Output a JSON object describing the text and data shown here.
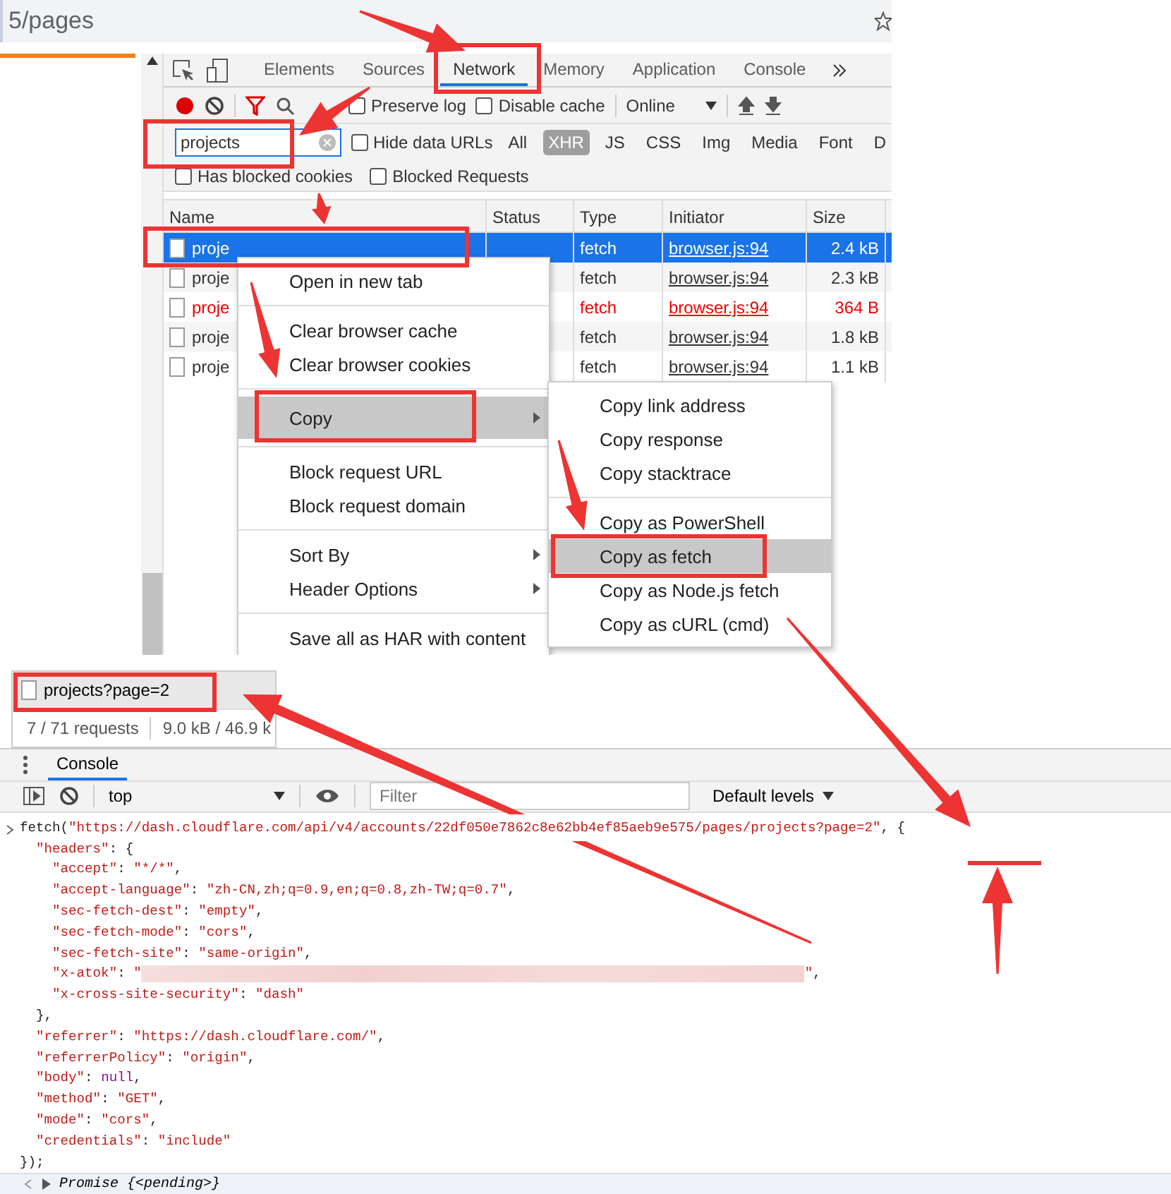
{
  "address_bar": {
    "url": "5/pages"
  },
  "devtools": {
    "tabs": [
      {
        "label": "Elements",
        "selected": false
      },
      {
        "label": "Sources",
        "selected": false
      },
      {
        "label": "Network",
        "selected": true
      },
      {
        "label": "Memory",
        "selected": false
      },
      {
        "label": "Application",
        "selected": false
      },
      {
        "label": "Console",
        "selected": false
      }
    ],
    "preserve_log": {
      "label": "Preserve log",
      "checked": false
    },
    "disable_cache": {
      "label": "Disable cache",
      "checked": false
    },
    "throttling": "Online",
    "filter": {
      "value": "projects"
    },
    "hide_data_urls": {
      "label": "Hide data URLs",
      "checked": false
    },
    "type_filters": [
      {
        "label": "All",
        "selected": false
      },
      {
        "label": "XHR",
        "selected": true
      },
      {
        "label": "JS",
        "selected": false
      },
      {
        "label": "CSS",
        "selected": false
      },
      {
        "label": "Img",
        "selected": false
      },
      {
        "label": "Media",
        "selected": false
      },
      {
        "label": "Font",
        "selected": false
      },
      {
        "label": "D",
        "selected": false
      }
    ],
    "has_blocked_cookies": {
      "label": "Has blocked cookies",
      "checked": false
    },
    "blocked_requests": {
      "label": "Blocked Requests",
      "checked": false
    },
    "columns": [
      "Name",
      "Status",
      "Type",
      "Initiator",
      "Size"
    ],
    "rows": [
      {
        "name": "proje",
        "type": "fetch",
        "initiator": "browser.js:94",
        "size": "2.4 kB",
        "selected": true,
        "failed": false
      },
      {
        "name": "proje",
        "type": "fetch",
        "initiator": "browser.js:94",
        "size": "2.3 kB",
        "selected": false,
        "failed": false
      },
      {
        "name": "proje",
        "type": "fetch",
        "initiator": "browser.js:94",
        "size": "364 B",
        "selected": false,
        "failed": true
      },
      {
        "name": "proje",
        "type": "fetch",
        "initiator": "browser.js:94",
        "size": "1.8 kB",
        "selected": false,
        "failed": false
      },
      {
        "name": "proje",
        "type": "fetch",
        "initiator": "browser.js:94",
        "size": "1.1 kB",
        "selected": false,
        "failed": false
      }
    ]
  },
  "context_menu": {
    "groups": [
      [
        {
          "label": "Open in new tab",
          "submenu": false,
          "highlighted": false
        }
      ],
      [
        {
          "label": "Clear browser cache",
          "submenu": false,
          "highlighted": false
        },
        {
          "label": "Clear browser cookies",
          "submenu": false,
          "highlighted": false
        }
      ],
      [
        {
          "label": "Copy",
          "submenu": true,
          "highlighted": true
        }
      ],
      [
        {
          "label": "Block request URL",
          "submenu": false,
          "highlighted": false
        },
        {
          "label": "Block request domain",
          "submenu": false,
          "highlighted": false
        }
      ],
      [
        {
          "label": "Sort By",
          "submenu": true,
          "highlighted": false
        },
        {
          "label": "Header Options",
          "submenu": true,
          "highlighted": false
        }
      ],
      [
        {
          "label": "Save all as HAR with content",
          "submenu": false,
          "highlighted": false
        }
      ]
    ]
  },
  "copy_submenu": {
    "groups": [
      [
        {
          "label": "Copy link address",
          "highlighted": false
        },
        {
          "label": "Copy response",
          "highlighted": false
        },
        {
          "label": "Copy stacktrace",
          "highlighted": false
        }
      ],
      [
        {
          "label": "Copy as PowerShell",
          "highlighted": false
        },
        {
          "label": "Copy as fetch",
          "highlighted": true
        },
        {
          "label": "Copy as Node.js fetch",
          "highlighted": false
        },
        {
          "label": "Copy as cURL (cmd)",
          "highlighted": false
        }
      ]
    ]
  },
  "request_list": {
    "row": "projects?page=2",
    "requests": "7 / 71 requests",
    "transferred": "9.0 kB / 46.9 k"
  },
  "console": {
    "tab": "Console",
    "context": "top",
    "filter_placeholder": "Filter",
    "levels": "Default levels",
    "lines": [
      [
        {
          "kind": "plain",
          "text": "fetch("
        },
        {
          "kind": "string",
          "text": "\"https://dash.cloudflare.com/api/v4/accounts/22df050e7862c8e62bb4ef85aeb9e575/pages/projects?page=2\""
        },
        {
          "kind": "plain",
          "text": ", {"
        }
      ],
      [
        {
          "kind": "string",
          "text": "\"headers\""
        },
        {
          "kind": "plain",
          "text": ": {"
        }
      ],
      [
        {
          "kind": "string",
          "text": "\"accept\""
        },
        {
          "kind": "plain",
          "text": ": "
        },
        {
          "kind": "string",
          "text": "\"*/*\""
        },
        {
          "kind": "plain",
          "text": ","
        }
      ],
      [
        {
          "kind": "string",
          "text": "\"accept-language\""
        },
        {
          "kind": "plain",
          "text": ": "
        },
        {
          "kind": "string",
          "text": "\"zh-CN,zh;q=0.9,en;q=0.8,zh-TW;q=0.7\""
        },
        {
          "kind": "plain",
          "text": ","
        }
      ],
      [
        {
          "kind": "string",
          "text": "\"sec-fetch-dest\""
        },
        {
          "kind": "plain",
          "text": ": "
        },
        {
          "kind": "string",
          "text": "\"empty\""
        },
        {
          "kind": "plain",
          "text": ","
        }
      ],
      [
        {
          "kind": "string",
          "text": "\"sec-fetch-mode\""
        },
        {
          "kind": "plain",
          "text": ": "
        },
        {
          "kind": "string",
          "text": "\"cors\""
        },
        {
          "kind": "plain",
          "text": ","
        }
      ],
      [
        {
          "kind": "string",
          "text": "\"sec-fetch-site\""
        },
        {
          "kind": "plain",
          "text": ": "
        },
        {
          "kind": "string",
          "text": "\"same-origin\""
        },
        {
          "kind": "plain",
          "text": ","
        }
      ],
      [
        {
          "kind": "string",
          "text": "\"x-atok\""
        },
        {
          "kind": "plain",
          "text": ": "
        },
        {
          "kind": "string",
          "text": "\""
        },
        {
          "kind": "redacted"
        },
        {
          "kind": "string",
          "text": "\""
        },
        {
          "kind": "plain",
          "text": ","
        }
      ],
      [
        {
          "kind": "string",
          "text": "\"x-cross-site-security\""
        },
        {
          "kind": "plain",
          "text": ": "
        },
        {
          "kind": "string",
          "text": "\"dash\""
        }
      ],
      [
        {
          "kind": "plain",
          "text": "},"
        }
      ],
      [
        {
          "kind": "string",
          "text": "\"referrer\""
        },
        {
          "kind": "plain",
          "text": ": "
        },
        {
          "kind": "string",
          "text": "\"https://dash.cloudflare.com/\""
        },
        {
          "kind": "plain",
          "text": ","
        }
      ],
      [
        {
          "kind": "string",
          "text": "\"referrerPolicy\""
        },
        {
          "kind": "plain",
          "text": ": "
        },
        {
          "kind": "string",
          "text": "\"origin\""
        },
        {
          "kind": "plain",
          "text": ","
        }
      ],
      [
        {
          "kind": "string",
          "text": "\"body\""
        },
        {
          "kind": "plain",
          "text": ": "
        },
        {
          "kind": "keyword",
          "text": "null"
        },
        {
          "kind": "plain",
          "text": ","
        }
      ],
      [
        {
          "kind": "string",
          "text": "\"method\""
        },
        {
          "kind": "plain",
          "text": ": "
        },
        {
          "kind": "string",
          "text": "\"GET\""
        },
        {
          "kind": "plain",
          "text": ","
        }
      ],
      [
        {
          "kind": "string",
          "text": "\"mode\""
        },
        {
          "kind": "plain",
          "text": ": "
        },
        {
          "kind": "string",
          "text": "\"cors\""
        },
        {
          "kind": "plain",
          "text": ","
        }
      ],
      [
        {
          "kind": "string",
          "text": "\"credentials\""
        },
        {
          "kind": "plain",
          "text": ": "
        },
        {
          "kind": "string",
          "text": "\"include\""
        }
      ],
      [
        {
          "kind": "plain",
          "text": "});"
        }
      ]
    ],
    "result": "Promise {<pending>}"
  }
}
